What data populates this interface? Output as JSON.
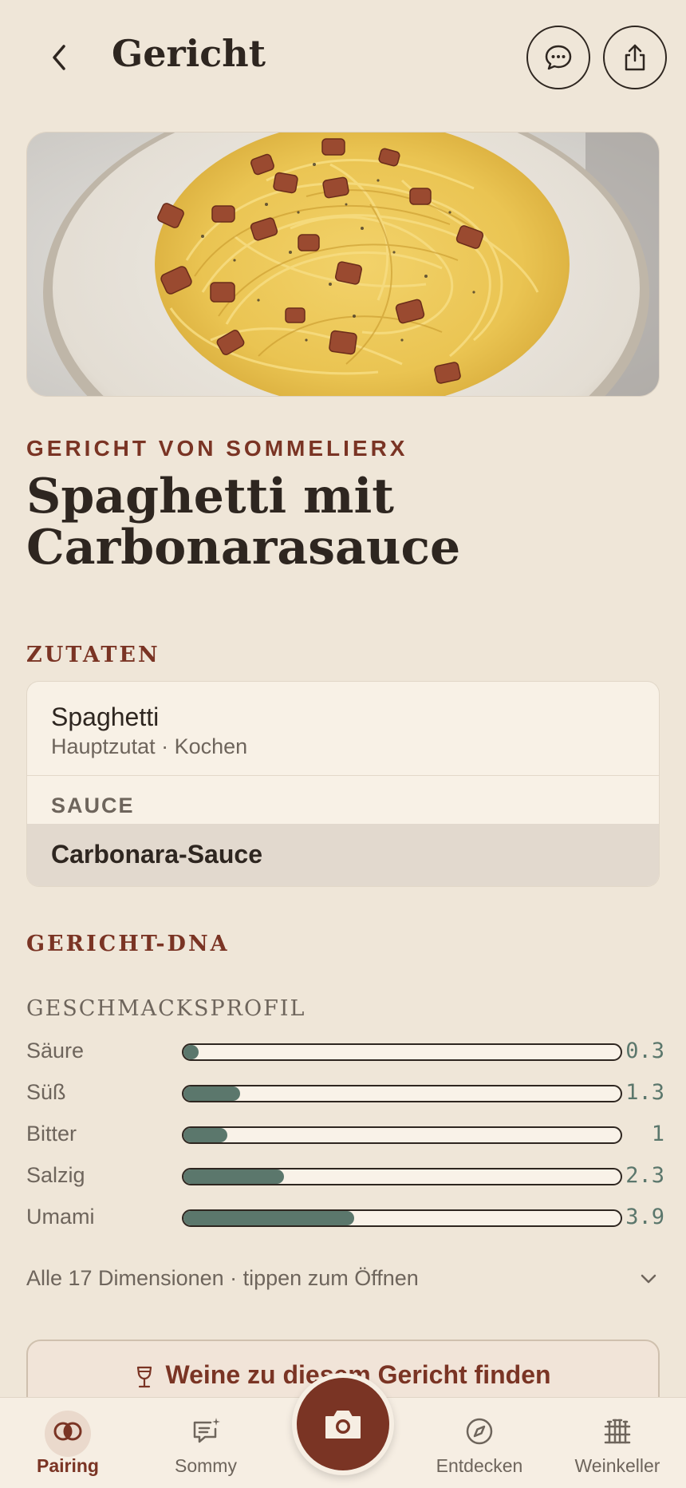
{
  "header": {
    "title": "Gericht"
  },
  "dish": {
    "kicker": "GERICHT VON SOMMELIERX",
    "title": "Spaghetti mit Carbonarasauce"
  },
  "ingredients": {
    "section_label": "ZUTATEN",
    "main": {
      "name": "Spaghetti",
      "detail": "Hauptzutat · Kochen"
    },
    "group_label": "SAUCE",
    "group_items": [
      "Carbonara-Sauce"
    ]
  },
  "dna": {
    "section_label": "GERICHT-DNA",
    "profile_label": "GESCHMACKSPROFIL",
    "taste": [
      {
        "name": "Säure",
        "value": 0.3,
        "display": "0.3"
      },
      {
        "name": "Süß",
        "value": 1.3,
        "display": "1.3"
      },
      {
        "name": "Bitter",
        "value": 1,
        "display": "1"
      },
      {
        "name": "Salzig",
        "value": 2.3,
        "display": "2.3"
      },
      {
        "name": "Umami",
        "value": 3.9,
        "display": "3.9"
      }
    ],
    "scale_max": 10,
    "expand_text": "Alle 17 Dimensionen · tippen zum Öffnen"
  },
  "cta": {
    "label": "Weine zu diesem Gericht finden"
  },
  "nav": {
    "items": [
      {
        "label": "Pairing",
        "icon": "pairing-icon",
        "active": true
      },
      {
        "label": "Sommy",
        "icon": "chat-sparkle-icon",
        "active": false
      },
      {
        "label": "Entdecken",
        "icon": "compass-icon",
        "active": false
      },
      {
        "label": "Weinkeller",
        "icon": "cellar-icon",
        "active": false
      }
    ]
  },
  "colors": {
    "background": "#efe6d8",
    "accent": "#7a3424",
    "bar_fill": "#5b776c",
    "text": "#2e2620"
  }
}
